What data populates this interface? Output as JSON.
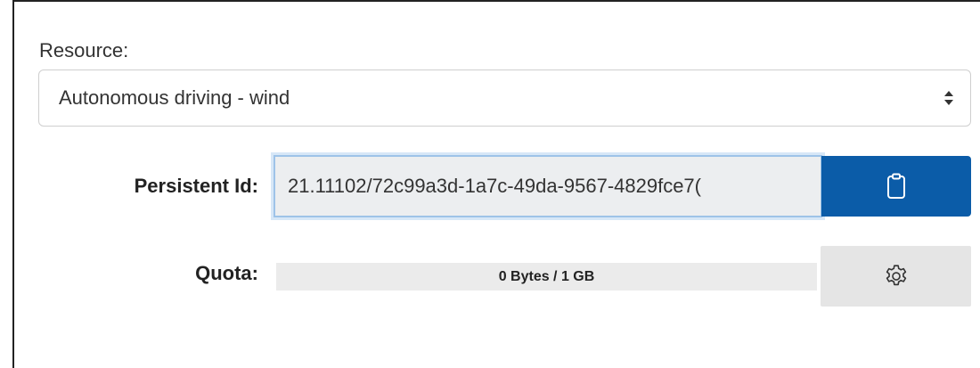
{
  "resource": {
    "label": "Resource:",
    "selected": "Autonomous driving - wind"
  },
  "persistent_id": {
    "label": "Persistent Id:",
    "value": "21.11102/72c99a3d-1a7c-49da-9567-4829fce7(",
    "copy_icon": "clipboard-icon"
  },
  "quota": {
    "label": "Quota:",
    "text": "0 Bytes / 1 GB",
    "used_fraction": 0,
    "settings_icon": "gear-icon"
  },
  "colors": {
    "primary": "#0b5ca8",
    "input_bg": "#eceef0",
    "input_border": "#9ec3e8",
    "quota_bg": "#ebebeb",
    "settings_bg": "#e5e5e5"
  }
}
